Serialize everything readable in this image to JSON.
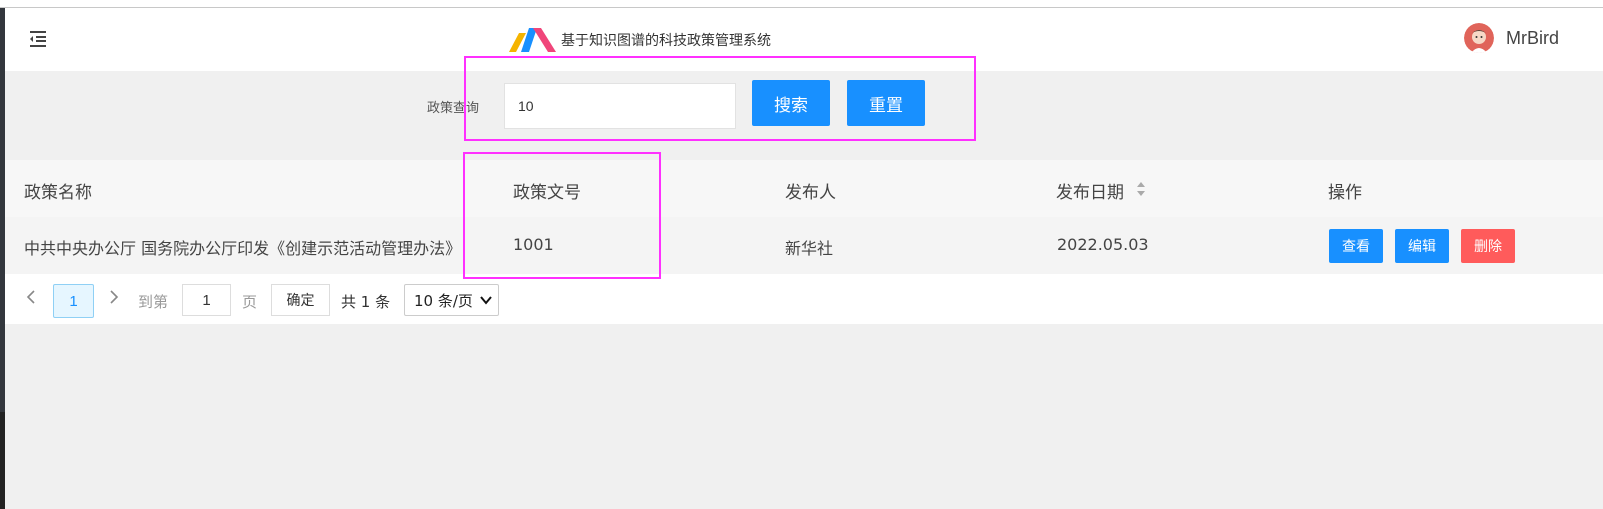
{
  "header": {
    "app_title": "基于知识图谱的科技政策管理系统",
    "username": "MrBird",
    "logo_colors": [
      "#f5b400",
      "#1890ff",
      "#f0457a"
    ]
  },
  "search": {
    "label": "政策查询",
    "value": "10",
    "search_button": "搜索",
    "reset_button": "重置"
  },
  "table": {
    "columns": [
      "政策名称",
      "政策文号",
      "发布人",
      "发布日期",
      "操作"
    ],
    "rows": [
      {
        "name": "中共中央办公厅 国务院办公厅印发《创建示范活动管理办法》",
        "doc_no": "1001",
        "publisher": "新华社",
        "date": "2022.05.03",
        "actions": [
          "查看",
          "编辑",
          "删除"
        ]
      }
    ]
  },
  "pagination": {
    "current_page": "1",
    "goto_label": "到第",
    "goto_value": "1",
    "page_unit": "页",
    "confirm_label": "确定",
    "total_label": "共 1 条",
    "page_size_option": "10 条/页"
  },
  "colors": {
    "primary": "#1890ff",
    "danger": "#ff5b5b",
    "highlight": "#ff30ff"
  }
}
